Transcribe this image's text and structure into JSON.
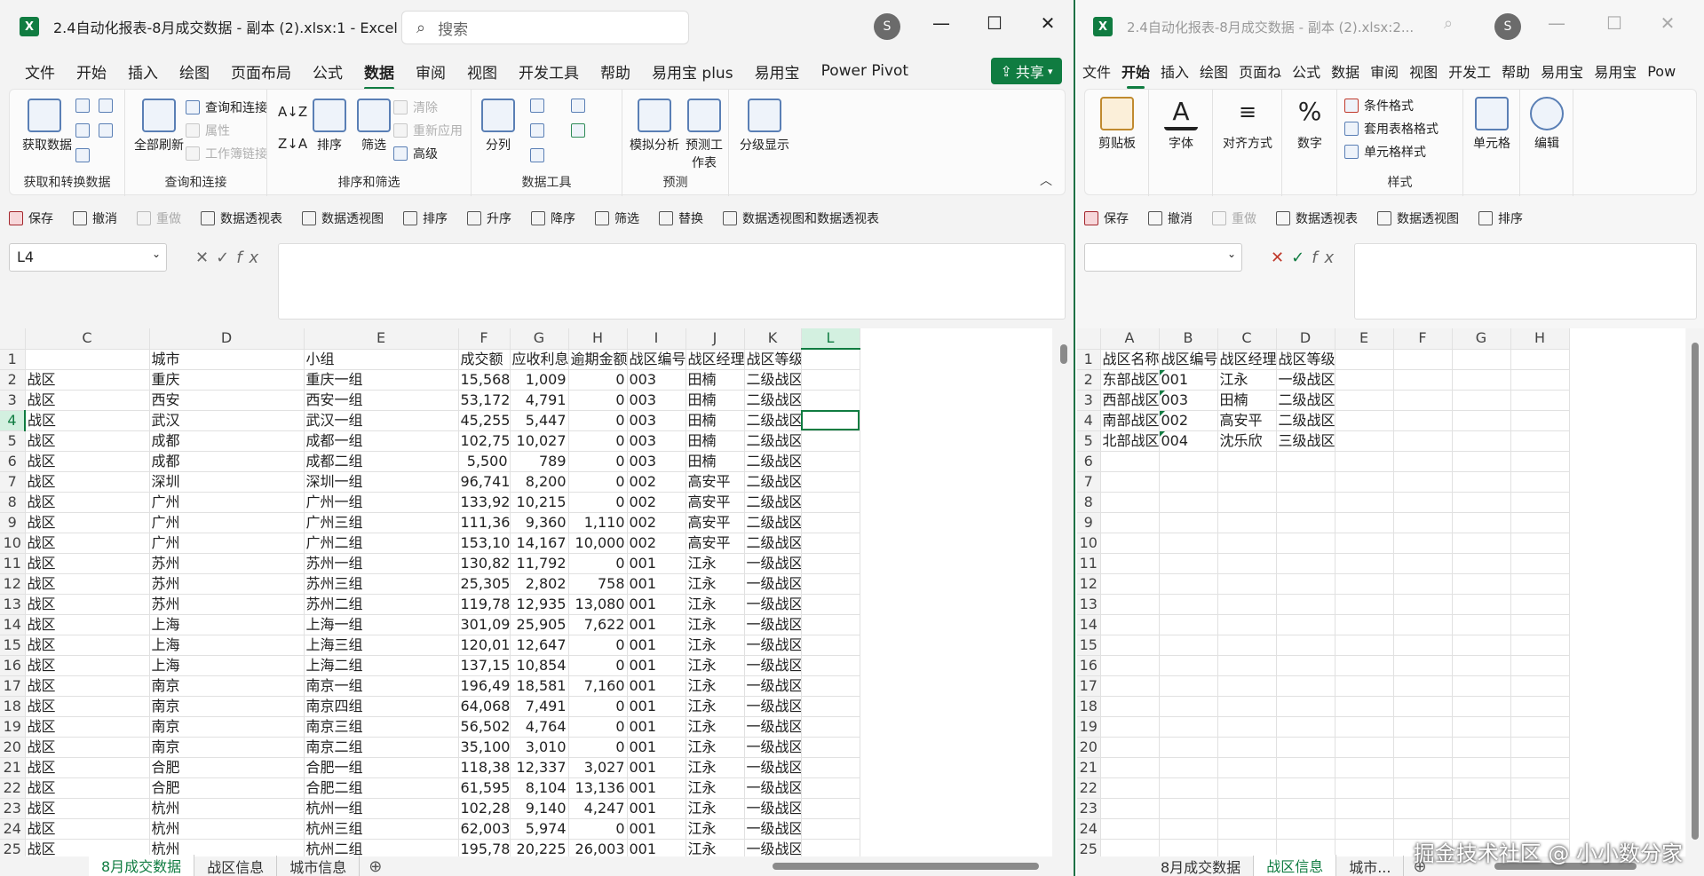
{
  "w1": {
    "title": "2.4自动化报表-8月成交数据 - 副本 (2).xlsx:1  -  Excel",
    "search_placeholder": "搜索",
    "avatar": "S",
    "tabs": [
      "文件",
      "开始",
      "插入",
      "绘图",
      "页面布局",
      "公式",
      "数据",
      "审阅",
      "视图",
      "开发工具",
      "帮助",
      "易用宝 plus",
      "易用宝",
      "Power Pivot"
    ],
    "active_tab": "数据",
    "share": "共享",
    "ribbon_groups": [
      {
        "label": "获取和转换数据",
        "big": [
          "获取数据"
        ]
      },
      {
        "label": "查询和连接",
        "big": [
          "全部刷新"
        ],
        "small": [
          "查询和连接",
          "属性",
          "工作簿链接"
        ]
      },
      {
        "label": "排序和筛选",
        "big": [
          "排序",
          "筛选"
        ],
        "small": [
          "清除",
          "重新应用",
          "高级"
        ]
      },
      {
        "label": "数据工具",
        "big": [
          "分列"
        ]
      },
      {
        "label": "预测",
        "big": [
          "模拟分析",
          "预测工作表"
        ]
      },
      {
        "label": "",
        "big": [
          "分级显示"
        ]
      }
    ],
    "qat": [
      "保存",
      "撤消",
      "重做",
      "数据透视表",
      "数据透视图",
      "排序",
      "升序",
      "降序",
      "筛选",
      "替换",
      "数据透视图和数据透视表"
    ],
    "namebox": "L4",
    "columns": [
      "C",
      "D",
      "E",
      "F",
      "G",
      "H",
      "I",
      "J",
      "K",
      "L"
    ],
    "header_row": [
      "",
      "城市",
      "小组",
      "成交额",
      "应收利息",
      "逾期金额",
      "战区编号",
      "战区经理",
      "战区等级",
      ""
    ],
    "rows": [
      [
        "战区",
        "重庆",
        "重庆一组",
        "15,568",
        "1,009",
        "0",
        "003",
        "田楠",
        "二级战区"
      ],
      [
        "战区",
        "西安",
        "西安一组",
        "53,172",
        "4,791",
        "0",
        "003",
        "田楠",
        "二级战区"
      ],
      [
        "战区",
        "武汉",
        "武汉一组",
        "45,255",
        "5,447",
        "0",
        "003",
        "田楠",
        "二级战区"
      ],
      [
        "战区",
        "成都",
        "成都一组",
        "102,755",
        "10,027",
        "0",
        "003",
        "田楠",
        "二级战区"
      ],
      [
        "战区",
        "成都",
        "成都二组",
        "5,500",
        "789",
        "0",
        "003",
        "田楠",
        "二级战区"
      ],
      [
        "战区",
        "深圳",
        "深圳一组",
        "96,741",
        "8,200",
        "0",
        "002",
        "高安平",
        "二级战区"
      ],
      [
        "战区",
        "广州",
        "广州一组",
        "133,925",
        "10,215",
        "0",
        "002",
        "高安平",
        "二级战区"
      ],
      [
        "战区",
        "广州",
        "广州三组",
        "111,362",
        "9,360",
        "1,110",
        "002",
        "高安平",
        "二级战区"
      ],
      [
        "战区",
        "广州",
        "广州二组",
        "153,104",
        "14,167",
        "10,000",
        "002",
        "高安平",
        "二级战区"
      ],
      [
        "战区",
        "苏州",
        "苏州一组",
        "130,822",
        "11,792",
        "0",
        "001",
        "江永",
        "一级战区"
      ],
      [
        "战区",
        "苏州",
        "苏州三组",
        "25,305",
        "2,802",
        "758",
        "001",
        "江永",
        "一级战区"
      ],
      [
        "战区",
        "苏州",
        "苏州二组",
        "119,789",
        "12,935",
        "13,080",
        "001",
        "江永",
        "一级战区"
      ],
      [
        "战区",
        "上海",
        "上海一组",
        "301,096",
        "25,905",
        "7,622",
        "001",
        "江永",
        "一级战区"
      ],
      [
        "战区",
        "上海",
        "上海三组",
        "120,013",
        "12,647",
        "0",
        "001",
        "江永",
        "一级战区"
      ],
      [
        "战区",
        "上海",
        "上海二组",
        "137,159",
        "10,854",
        "0",
        "001",
        "江永",
        "一级战区"
      ],
      [
        "战区",
        "南京",
        "南京一组",
        "196,498",
        "18,581",
        "7,160",
        "001",
        "江永",
        "一级战区"
      ],
      [
        "战区",
        "南京",
        "南京四组",
        "64,068",
        "7,491",
        "0",
        "001",
        "江永",
        "一级战区"
      ],
      [
        "战区",
        "南京",
        "南京三组",
        "56,502",
        "4,764",
        "0",
        "001",
        "江永",
        "一级战区"
      ],
      [
        "战区",
        "南京",
        "南京二组",
        "35,100",
        "3,010",
        "0",
        "001",
        "江永",
        "一级战区"
      ],
      [
        "战区",
        "合肥",
        "合肥一组",
        "118,385",
        "12,337",
        "3,027",
        "001",
        "江永",
        "一级战区"
      ],
      [
        "战区",
        "合肥",
        "合肥二组",
        "61,595",
        "8,104",
        "13,136",
        "001",
        "江永",
        "一级战区"
      ],
      [
        "战区",
        "杭州",
        "杭州一组",
        "102,282",
        "9,140",
        "4,247",
        "001",
        "江永",
        "一级战区"
      ],
      [
        "战区",
        "杭州",
        "杭州三组",
        "62,003",
        "5,974",
        "0",
        "001",
        "江永",
        "一级战区"
      ],
      [
        "战区",
        "杭州",
        "杭州二组",
        "195,786",
        "20,225",
        "26,003",
        "001",
        "江永",
        "一级战区"
      ]
    ],
    "sheets": [
      "8月成交数据",
      "战区信息",
      "城市信息"
    ],
    "active_sheet": "8月成交数据"
  },
  "w2": {
    "title": "2.4自动化报表-8月成交数据 - 副本 (2).xlsx:2...",
    "avatar": "S",
    "tabs": [
      "文件",
      "开始",
      "插入",
      "绘图",
      "页面ね",
      "公式",
      "数据",
      "审阅",
      "视图",
      "开发工",
      "帮助",
      "易用宝",
      "易用宝",
      "Pow"
    ],
    "active_tab": "开始",
    "ribbon": [
      "剪贴板",
      "字体",
      "对齐方式",
      "数字",
      "条件格式",
      "套用表格格式",
      "单元格样式",
      "单元格",
      "编辑",
      "样式"
    ],
    "qat": [
      "保存",
      "撤消",
      "重做",
      "数据透视表",
      "数据透视图",
      "排序"
    ],
    "namebox": "",
    "columns": [
      "A",
      "B",
      "C",
      "D",
      "E",
      "F",
      "G",
      "H"
    ],
    "rows": [
      [
        "战区名称",
        "战区编号",
        "战区经理",
        "战区等级"
      ],
      [
        "东部战区",
        "001",
        "江永",
        "一级战区"
      ],
      [
        "西部战区",
        "003",
        "田楠",
        "二级战区"
      ],
      [
        "南部战区",
        "002",
        "高安平",
        "二级战区"
      ],
      [
        "北部战区",
        "004",
        "沈乐欣",
        "三级战区"
      ]
    ],
    "sheets": [
      "8月成交数据",
      "战区信息",
      "城市..."
    ],
    "active_sheet": "战区信息",
    "watermark": "掘金技术社区 @ 小小数分家"
  }
}
